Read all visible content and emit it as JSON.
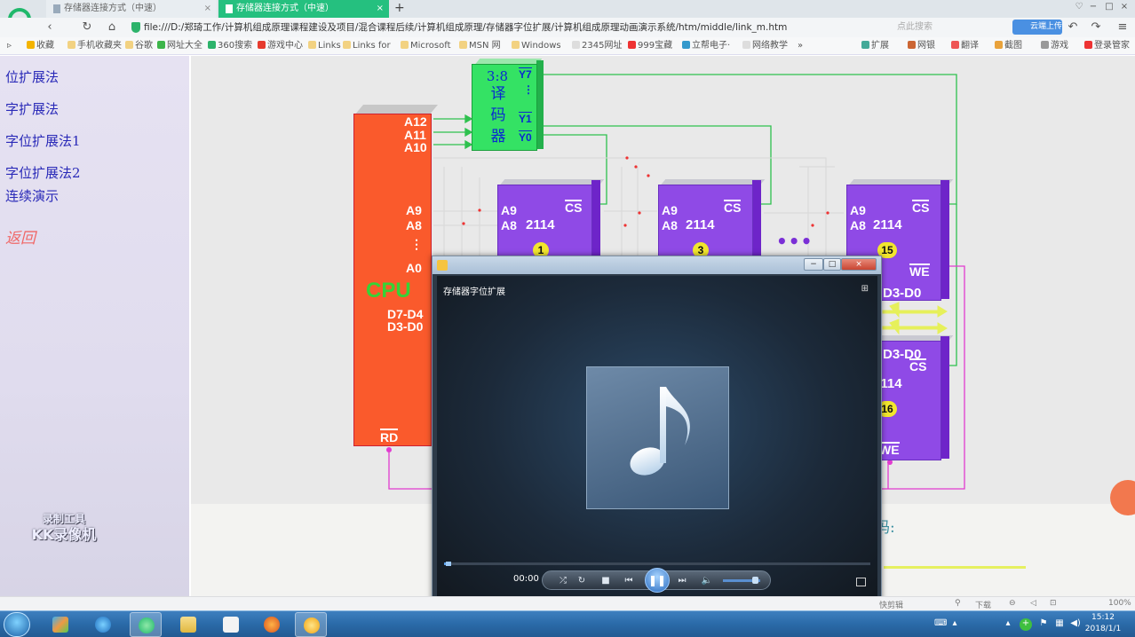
{
  "browser": {
    "tabs": [
      {
        "label": "存储器连接方式（中速）",
        "active": false
      },
      {
        "label": "存储器连接方式（中速）",
        "active": true
      }
    ],
    "new_tab": "+",
    "url": "file:///D:/郑琦工作/计算机组成原理课程建设及项目/混合课程后续/计算机组成原理/存储器字位扩展/计算机组成原理动画演示系统/htm/middle/link_m.htm",
    "search_placeholder": "点此搜索",
    "cloud_button": "云端上传",
    "bookmarks": [
      "收藏",
      "手机收藏夹",
      "谷歌",
      "网址大全",
      "360搜索",
      "游戏中心",
      "Links",
      "Links for",
      "Microsoft",
      "MSN 网",
      "Windows",
      "2345网址",
      "999宝藏",
      "立帮电子·",
      "网络教学",
      "»"
    ],
    "toolbar_right": [
      "扩展",
      "网银",
      "翻译",
      "截图",
      "游戏",
      "登录管家"
    ]
  },
  "sidebar": {
    "links": [
      "位扩展法",
      "字扩展法",
      "字位扩展法1",
      "字位扩展法2",
      "连续演示"
    ],
    "back": "返回",
    "watermark": [
      "录制工具",
      "KK录像机"
    ]
  },
  "diagram": {
    "cpu": {
      "label": "CPU",
      "pins": [
        "A12",
        "A11",
        "A10",
        "A9",
        "A8",
        "⋮",
        "A0",
        "D7-D4",
        "D3-D0",
        "RD"
      ]
    },
    "decoder": {
      "lines": [
        "3:8",
        "译",
        "码",
        "器"
      ],
      "outputs": [
        "Y7",
        "⋮",
        "Y1",
        "Y0"
      ]
    },
    "chips": [
      {
        "cs": "CS",
        "a9": "A9",
        "a8": "A8",
        "model": "2114",
        "number": "1"
      },
      {
        "cs": "CS",
        "a9": "A9",
        "a8": "A8",
        "model": "2114",
        "number": "3"
      },
      {
        "cs": "CS",
        "a9": "A9",
        "a8": "A8",
        "model": "2114",
        "number": "15",
        "we": "WE",
        "data": "D3-D0"
      },
      {
        "cs": "CS",
        "model": "2114",
        "number": "16",
        "we": "WE",
        "data": "D3-D0"
      }
    ],
    "ellipsis": "•••",
    "lower_hint": "码:"
  },
  "player": {
    "title": "存储器字位扩展",
    "time": "00:00",
    "progress": 0.01,
    "volume": 0.85,
    "controls": [
      "shuffle",
      "repeat",
      "stop",
      "previous",
      "pause",
      "next",
      "mute"
    ]
  },
  "statusbar": {
    "items": [
      "快剪辑",
      "下载",
      "100%"
    ]
  },
  "taskbar": {
    "time": "15:12",
    "date": "2018/1/1"
  },
  "colors": {
    "cpu": "#fa5a2c",
    "decoder": "#34e264",
    "chip": "#8f4ae6",
    "sidebar_link": "#2a2ab8",
    "back_link": "#f06868",
    "tab_active": "#25c07f"
  }
}
